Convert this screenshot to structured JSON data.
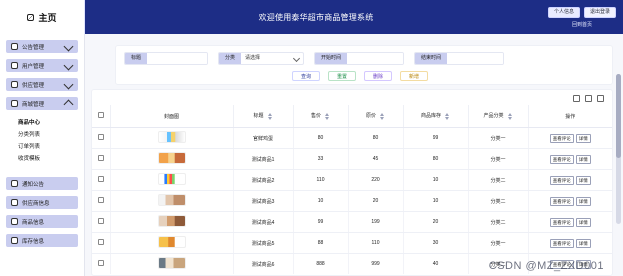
{
  "topbar": {
    "brand": "主页",
    "title": "欢迎使用泰华超市商品管理系统",
    "user_pill": "个人信息",
    "exit_pill": "退出登录",
    "back_link": "回到首页"
  },
  "sidebar": {
    "items": [
      {
        "label": "公告管理",
        "icon": "notice-icon",
        "expandable": true
      },
      {
        "label": "用户管理",
        "icon": "user-icon",
        "expandable": true
      },
      {
        "label": "供应管理",
        "icon": "supply-icon",
        "expandable": true
      },
      {
        "label": "商城管理",
        "icon": "shop-icon",
        "expandable": true
      }
    ],
    "submenu": [
      {
        "label": "商品中心",
        "active": true
      },
      {
        "label": "分类列表",
        "active": false
      },
      {
        "label": "订单列表",
        "active": false
      },
      {
        "label": "收货模板",
        "active": false
      }
    ],
    "items_bottom": [
      {
        "label": "通知公告",
        "icon": "bell-icon"
      },
      {
        "label": "供应商信息",
        "icon": "vendor-icon"
      },
      {
        "label": "商品信息",
        "icon": "goods-icon"
      },
      {
        "label": "库存信息",
        "icon": "stock-icon"
      }
    ]
  },
  "filters": {
    "fields": [
      {
        "label": "标题",
        "placeholder": "",
        "value": ""
      },
      {
        "label": "分类",
        "select_value": "请选择"
      },
      {
        "label": "开始时间",
        "placeholder": "",
        "value": ""
      },
      {
        "label": "结束时间",
        "placeholder": "",
        "value": ""
      }
    ],
    "buttons": [
      "查询",
      "重置",
      "删除",
      "新增"
    ]
  },
  "table": {
    "columns": [
      "封面图",
      "标题",
      "售价",
      "原价",
      "商品库存",
      "产品分类",
      "操作"
    ],
    "rows": [
      {
        "title": "官鲜鸡蛋",
        "price": "80",
        "orig": "80",
        "stock": "99",
        "cat": "分类一"
      },
      {
        "title": "测试商品1",
        "price": "33",
        "orig": "45",
        "stock": "80",
        "cat": "分类一"
      },
      {
        "title": "测试商品2",
        "price": "110",
        "orig": "220",
        "stock": "10",
        "cat": "分类二"
      },
      {
        "title": "测试商品3",
        "price": "10",
        "orig": "20",
        "stock": "10",
        "cat": "分类二"
      },
      {
        "title": "测试商品4",
        "price": "99",
        "orig": "199",
        "stock": "20",
        "cat": "分类二"
      },
      {
        "title": "测试商品5",
        "price": "88",
        "orig": "110",
        "stock": "30",
        "cat": "分类一"
      },
      {
        "title": "测试商品6",
        "price": "888",
        "orig": "999",
        "stock": "40",
        "cat": "分类二"
      }
    ],
    "op_labels": [
      "查看评论",
      "详情"
    ]
  },
  "watermark": "CSDN @MZ_ZXD001",
  "colors": {
    "topbar": "#1d2d86",
    "sidebar_item": "#c9cdef",
    "filter_label": "#c9cdef"
  }
}
